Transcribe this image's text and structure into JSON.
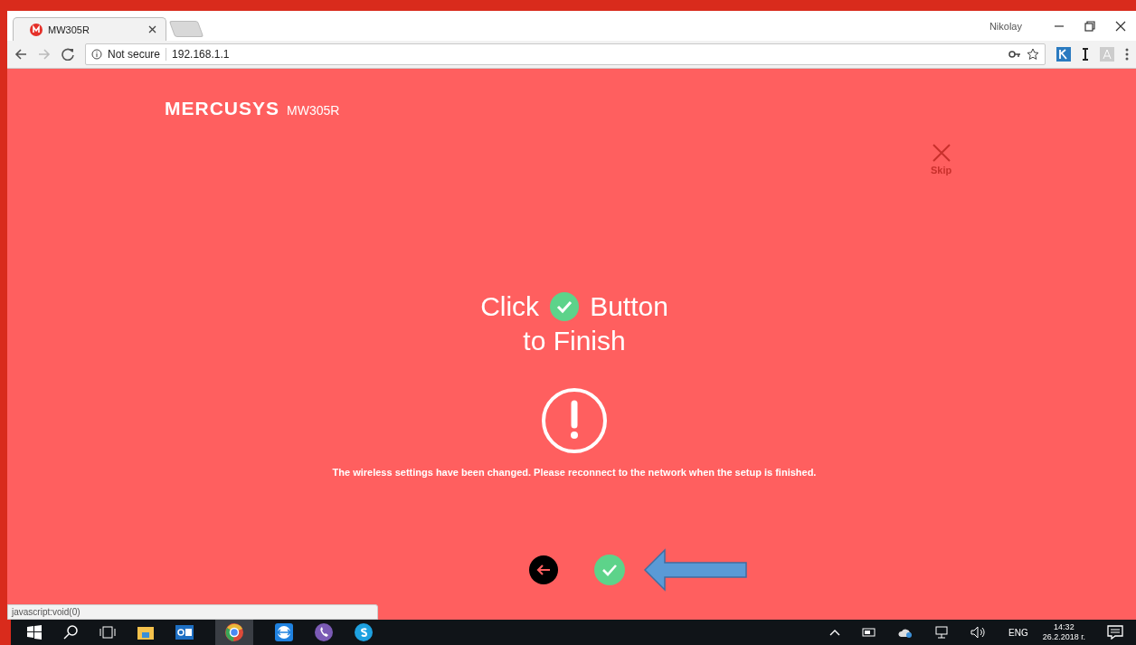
{
  "browser": {
    "tabs": [
      {
        "title": "MW305R",
        "selected": true
      }
    ],
    "user": "Nikolay",
    "address": {
      "security": "Not secure",
      "url": "192.168.1.1"
    },
    "status_text": "javascript:void(0)"
  },
  "page": {
    "brand": "MERCUSYS",
    "model": "MW305R",
    "skip": "Skip",
    "heading_start": "Click",
    "heading_end": "Button",
    "heading_line2": "to Finish",
    "message": "The wireless settings have been changed. Please reconnect to the network when the setup is finished."
  },
  "taskbar": {
    "language": "ENG",
    "time": "14:32",
    "date": "26.2.2018 г."
  }
}
